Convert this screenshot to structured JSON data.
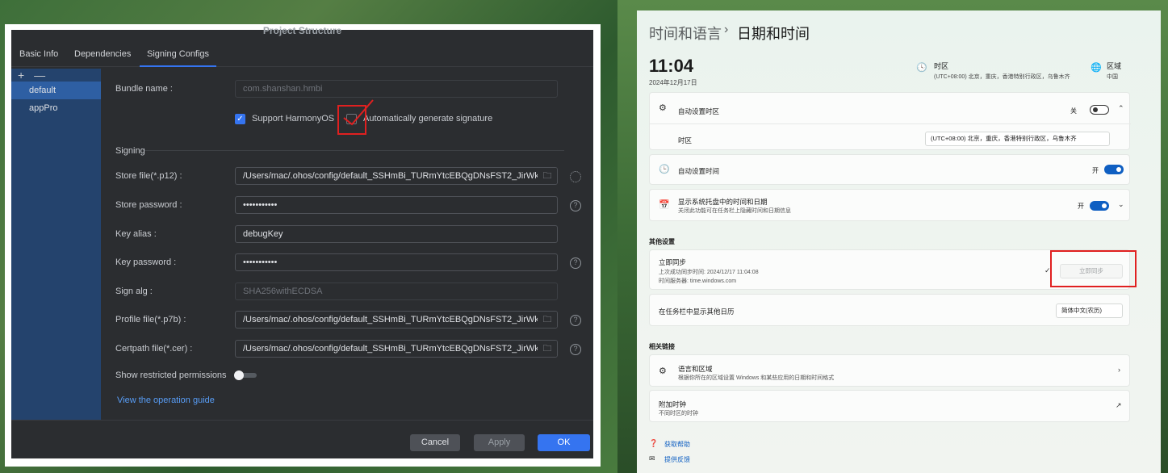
{
  "left": {
    "dialog_title": "Project Structure",
    "tabs": [
      "Basic Info",
      "Dependencies",
      "Signing Configs"
    ],
    "active_tab": "Signing Configs",
    "side_tools": [
      "+",
      "—"
    ],
    "side_items": [
      "default",
      "appPro"
    ],
    "bundle_label": "Bundle name :",
    "bundle_value": "com.shanshan.hmbi",
    "support_harmony": "Support HarmonyOS",
    "auto_sign": "Automatically generate signature",
    "signing_header": "Signing",
    "store_file_label": "Store file(*.p12) :",
    "store_file_value": "/Users/mac/.ohos/config/default_SSHmBi_TURmYtcEBQgDNsFST2_JirWk(",
    "store_pwd_label": "Store password :",
    "store_pwd_value": "•••••••••••",
    "key_alias_label": "Key alias :",
    "key_alias_value": "debugKey",
    "key_pwd_label": "Key password :",
    "key_pwd_value": "•••••••••••",
    "sign_alg_label": "Sign alg :",
    "sign_alg_value": "SHA256withECDSA",
    "profile_label": "Profile file(*.p7b) :",
    "profile_value": "/Users/mac/.ohos/config/default_SSHmBi_TURmYtcEBQgDNsFST2_JirWk(",
    "cert_label": "Certpath file(*.cer) :",
    "cert_value": "/Users/mac/.ohos/config/default_SSHmBi_TURmYtcEBQgDNsFST2_JirWk(",
    "restricted_label": "Show restricted permissions",
    "guide_link": "View the operation guide",
    "buttons": {
      "cancel": "Cancel",
      "apply": "Apply",
      "ok": "OK"
    },
    "help_glyph": "?",
    "folder_glyph": "🗀",
    "check_glyph": "✓"
  },
  "right": {
    "crumb_parent": "时间和语言",
    "crumb_sep": "›",
    "crumb_current": "日期和时间",
    "time": "11:04",
    "date": "2024年12月17日",
    "tz_title": "时区",
    "tz_sub": "(UTC+08:00) 北京，重庆，香港特别行政区，乌鲁木齐",
    "region_title": "区域",
    "region_sub": "中国",
    "auto_tz": "自动设置时区",
    "auto_tz_state": "关",
    "tz_row": "时区",
    "tz_select": "(UTC+08:00) 北京，重庆，香港特别行政区，乌鲁木齐",
    "auto_time": "自动设置时间",
    "auto_time_state": "开",
    "tray_title": "显示系统托盘中的时间和日期",
    "tray_sub": "关闭此功能可在任务栏上隐藏时间和日期信息",
    "tray_state": "开",
    "other_header": "其他设置",
    "sync_title": "立即同步",
    "sync_last": "上次成功同步时间: 2024/12/17 11:04:08",
    "sync_server": "时间服务器: time.windows.com",
    "sync_button": "立即同步",
    "calendar_title": "在任务栏中显示其他日历",
    "calendar_select": "简体中文(农历)",
    "related_header": "相关链接",
    "lang_title": "语言和区域",
    "lang_sub": "根据你所在的区域设置 Windows 和某些应用的日期和时间格式",
    "clock_title": "附加时钟",
    "clock_sub": "不同时区的时钟",
    "help_link": "获取帮助",
    "feedback_link": "提供反馈",
    "accent_color": "#0f5fc2"
  }
}
